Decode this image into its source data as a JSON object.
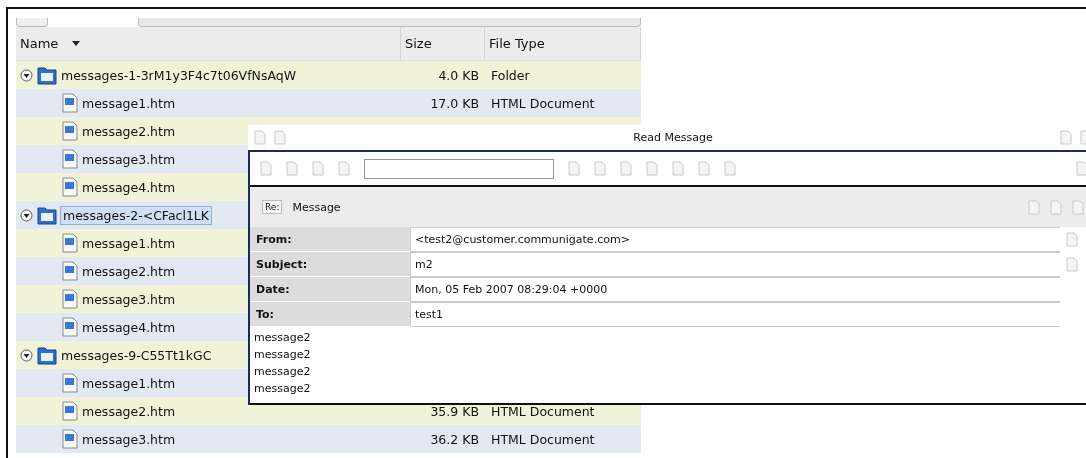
{
  "file_list": {
    "columns": [
      {
        "label": "Name",
        "sorted": true
      },
      {
        "label": "Size",
        "sorted": false
      },
      {
        "label": "File Type",
        "sorted": false
      }
    ],
    "rows": [
      {
        "kind": "folder",
        "name": "messages-1-3rM1y3F4c7t06VfNsAqW",
        "size": "4.0 KB",
        "type": "Folder",
        "expanded": true,
        "selected": false,
        "children": [
          {
            "kind": "file",
            "name": "message1.htm",
            "size": "17.0 KB",
            "type": "HTML Document"
          },
          {
            "kind": "file",
            "name": "message2.htm"
          },
          {
            "kind": "file",
            "name": "message3.htm"
          },
          {
            "kind": "file",
            "name": "message4.htm"
          }
        ]
      },
      {
        "kind": "folder",
        "name": "messages-2-<CFacl1LK",
        "expanded": true,
        "selected": true,
        "children": [
          {
            "kind": "file",
            "name": "message1.htm"
          },
          {
            "kind": "file",
            "name": "message2.htm"
          },
          {
            "kind": "file",
            "name": "message3.htm"
          },
          {
            "kind": "file",
            "name": "message4.htm"
          }
        ]
      },
      {
        "kind": "folder",
        "name": "messages-9-C55Tt1kGC",
        "expanded": true,
        "selected": false,
        "children": [
          {
            "kind": "file",
            "name": "message1.htm"
          },
          {
            "kind": "file",
            "name": "message2.htm",
            "size": "35.9 KB",
            "type": "HTML Document"
          },
          {
            "kind": "file",
            "name": "message3.htm",
            "size": "36.2 KB",
            "type": "HTML Document"
          }
        ]
      }
    ]
  },
  "dialog": {
    "title": "Read Message",
    "reply_badge": "Re:",
    "section_label": "Message",
    "fields": [
      {
        "label": "From:",
        "value": "<test2@customer.communigate.com>"
      },
      {
        "label": "Subject:",
        "value": "m2"
      },
      {
        "label": "Date:",
        "value": "Mon, 05 Feb 2007 08:29:04 +0000"
      },
      {
        "label": "To:",
        "value": "test1"
      }
    ],
    "body": [
      "message2",
      "message2",
      "message2",
      "message2"
    ]
  }
}
